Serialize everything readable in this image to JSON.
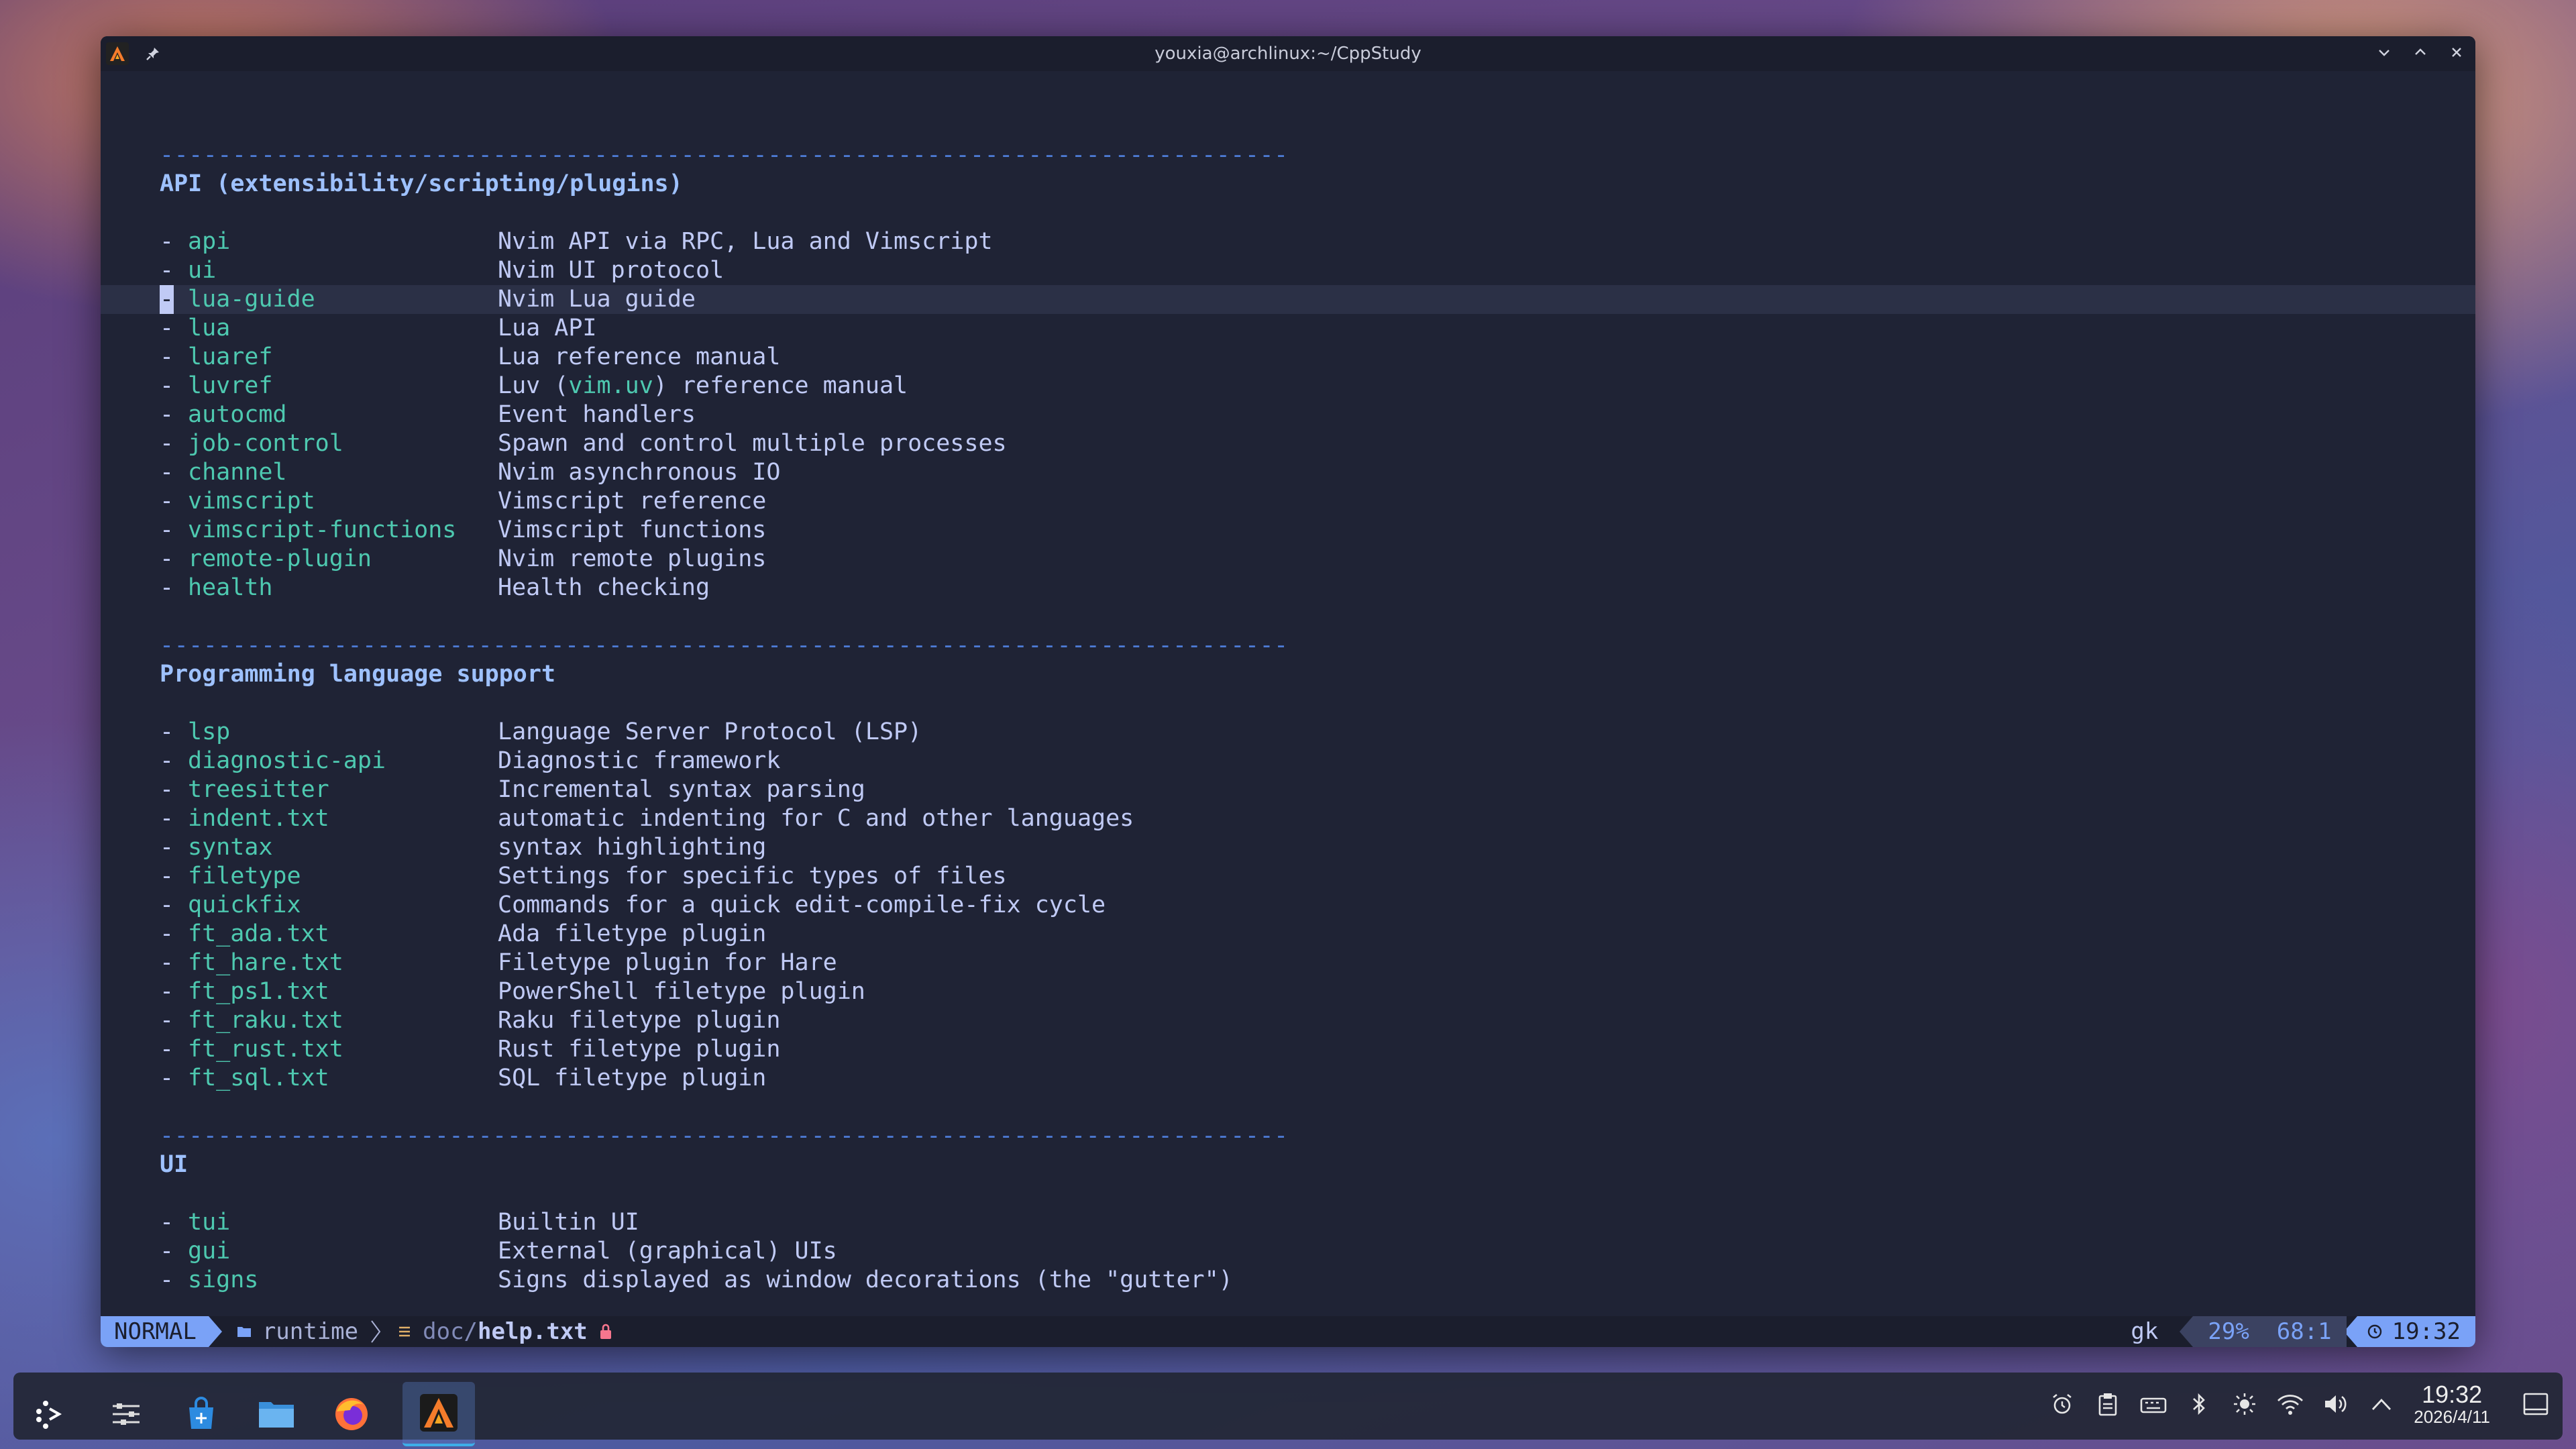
{
  "window": {
    "title": "youxia@archlinux:~/CppStudy"
  },
  "separator": "------------------------------------------------------------------------------",
  "sections": {
    "api": {
      "heading": "API (extensibility/scripting/plugins)",
      "items": [
        {
          "tag": "api",
          "desc": "Nvim API via RPC, Lua and Vimscript"
        },
        {
          "tag": "ui",
          "desc": "Nvim UI protocol"
        },
        {
          "tag": "lua-guide",
          "desc": "Nvim Lua guide"
        },
        {
          "tag": "lua",
          "desc": "Lua API"
        },
        {
          "tag": "luaref",
          "desc": "Lua reference manual"
        },
        {
          "tag": "luvref",
          "desc_pre": "Luv (",
          "desc_link": "vim.uv",
          "desc_post": ") reference manual"
        },
        {
          "tag": "autocmd",
          "desc": "Event handlers"
        },
        {
          "tag": "job-control",
          "desc": "Spawn and control multiple processes"
        },
        {
          "tag": "channel",
          "desc": "Nvim asynchronous IO"
        },
        {
          "tag": "vimscript",
          "desc": "Vimscript reference"
        },
        {
          "tag": "vimscript-functions",
          "desc": "Vimscript functions"
        },
        {
          "tag": "remote-plugin",
          "desc": "Nvim remote plugins"
        },
        {
          "tag": "health",
          "desc": "Health checking"
        }
      ]
    },
    "lang": {
      "heading": "Programming language support",
      "items": [
        {
          "tag": "lsp",
          "desc": "Language Server Protocol (LSP)"
        },
        {
          "tag": "diagnostic-api",
          "desc": "Diagnostic framework"
        },
        {
          "tag": "treesitter",
          "desc": "Incremental syntax parsing"
        },
        {
          "tag": "indent.txt",
          "desc": "automatic indenting for C and other languages"
        },
        {
          "tag": "syntax",
          "desc": "syntax highlighting"
        },
        {
          "tag": "filetype",
          "desc": "Settings for specific types of files"
        },
        {
          "tag": "quickfix",
          "desc": "Commands for a quick edit-compile-fix cycle"
        },
        {
          "tag": "ft_ada.txt",
          "desc": "Ada filetype plugin"
        },
        {
          "tag": "ft_hare.txt",
          "desc": "Filetype plugin for Hare"
        },
        {
          "tag": "ft_ps1.txt",
          "desc": "PowerShell filetype plugin"
        },
        {
          "tag": "ft_raku.txt",
          "desc": "Raku filetype plugin"
        },
        {
          "tag": "ft_rust.txt",
          "desc": "Rust filetype plugin"
        },
        {
          "tag": "ft_sql.txt",
          "desc": "SQL filetype plugin"
        }
      ]
    },
    "ui": {
      "heading": "UI",
      "items": [
        {
          "tag": "tui",
          "desc": "Builtin UI"
        },
        {
          "tag": "gui",
          "desc": "External (graphical) UIs"
        },
        {
          "tag": "signs",
          "desc": "Signs displayed as window decorations (the \"gutter\")"
        }
      ]
    }
  },
  "statusline": {
    "mode": "NORMAL",
    "dir": "runtime",
    "file_dir": "doc/",
    "file_name": "help.txt",
    "keys": "gk",
    "percent": "29%",
    "position": "68:1",
    "time": "19:32"
  },
  "taskbar": {
    "clock_time": "19:32",
    "clock_date": "2026/4/11"
  },
  "colors": {
    "accent": "#7aa2f7",
    "tag": "#4ec9b0",
    "heading": "#9ec1ff",
    "text": "#c0caf5",
    "background": "#1f2335"
  }
}
